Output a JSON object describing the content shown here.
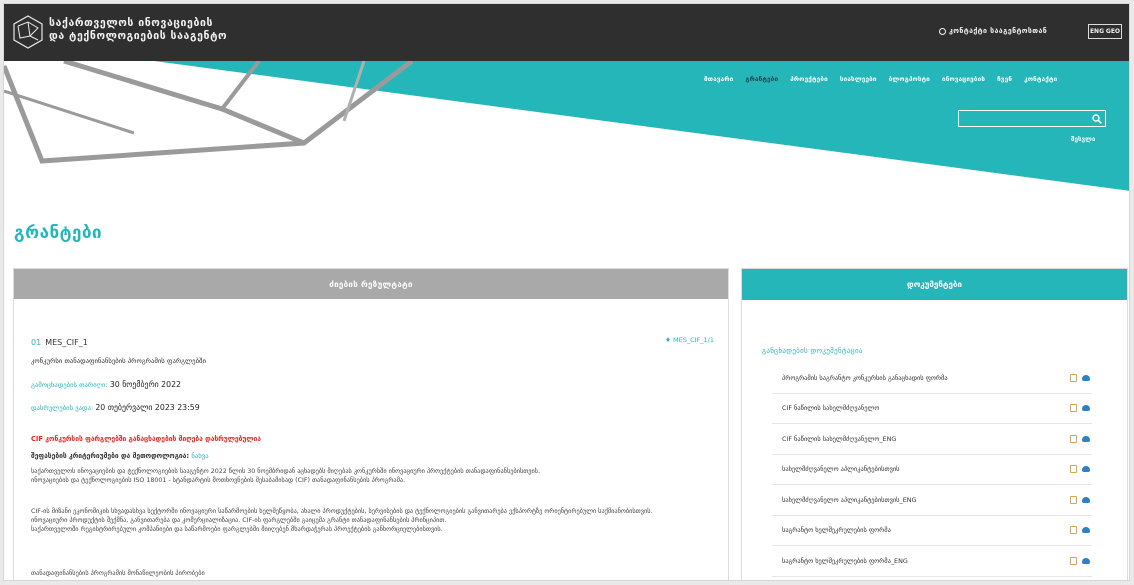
{
  "header": {
    "org_line1": "საქართველოს ინოვაციების",
    "org_line2": "და ტექნოლოგიების სააგენტო",
    "contact_label": "კონტაქტი სააგენტოსთან",
    "lang_options": [
      "ENG",
      "GEO"
    ]
  },
  "nav": {
    "items": [
      {
        "label": "მთავარი",
        "active": false
      },
      {
        "label": "გრანტები",
        "active": true
      },
      {
        "label": "პროექტები",
        "active": false
      },
      {
        "label": "სიახლეები",
        "active": false
      },
      {
        "label": "ბლოგპოსტი",
        "active": false
      },
      {
        "label": "ინოვაციების",
        "active": false
      },
      {
        "label": "ჩვენ",
        "active": false
      },
      {
        "label": "კონტაქტი",
        "active": false
      }
    ],
    "search_placeholder": "",
    "login_label": "შესვლა"
  },
  "page_title": "გრანტები",
  "detail": {
    "panel_title": "ძიების რეზულტატი",
    "code_index": "01",
    "code": "MES_CIF_1",
    "tag": "MES_CIF_1/1",
    "subtitle": "კონკურსი თანადაფინანსების პროგრამის ფარგლებში",
    "announced_label": "გამოცხადების თარიღი:",
    "announced_value": "30 ნოემბერი 2022",
    "deadline_label": "დასრულების ვადა:",
    "deadline_value": "20 თებერვალი 2023 23:59",
    "alert": "CIF კონკურსის ფარგლებში განაცხადების მიღება დასრულებულია",
    "method_label": "შეფასების კრიტერიუმები და მეთოდოლოგია:",
    "method_link": "ნახვა",
    "para1_line1": "საქართველოს ინოვაციების და ტექნოლოგიების სააგენტო 2022 წლის 30 ნოემბრიდან აცხადებს მიღებას კონკურსში ინოვაციური პროექტების თანადაფინანსებისთვის.",
    "para1_line2": "ინოვაციების და ტექნოლოგიების ISO 18001 - სტანდარტის მოთხოვნების შესაბამისად (CIF) თანადაფინანსების პროგრამა.",
    "para2_line1": "CIF-ის მიზანი ეკონომიკის სხვადასხვა სექტორში ინოვაციური საწარმოების ხელშეწყობა, ახალი პროდუქტების, სერვისების და ტექნოლოგიების განვითარება ექსპორტზე ორიენტირებული საქმიანობისთვის.",
    "para2_line2": "ინოვაციური პროდუქტის შექმნა, განვითარება და კომერციალიზაცია. CIF-ის ფარგლებში გაიცემა გრანტი თანადაფინანსების პრინციპით.",
    "para2_line3": "საქართველოში რეგისტრირებული კომპანიები და საწარმოები ფარგლებში მიიღებენ მხარდაჭერას პროექტების განხორციელებისთვის.",
    "para3": "თანადაფინანსების პროგრამის მონაწილეობის პირობები"
  },
  "files": {
    "panel_title": "დოკუმენტები",
    "section_heading": "განცხადების დოკუმენტაცია",
    "items": [
      "პროგრამის საგრანტო კონკურსის განაცხადის ფორმა",
      "CIF ნაწილის სახელმძღვანელო",
      "CIF ნაწილის სახელმძღვანელო_ENG",
      "სახელმძღვანელო აპლიკანტებისთვის",
      "სახელმძღვანელო აპლიკანტებისთვის_ENG",
      "საგრანტო ხელშეკრულების ფორმა",
      "საგრანტო ხელშეკრულების ფორმა_ENG"
    ]
  },
  "colors": {
    "teal": "#25b6ba",
    "header_dark": "#2f2f2f",
    "alert_red": "#e5271d"
  }
}
